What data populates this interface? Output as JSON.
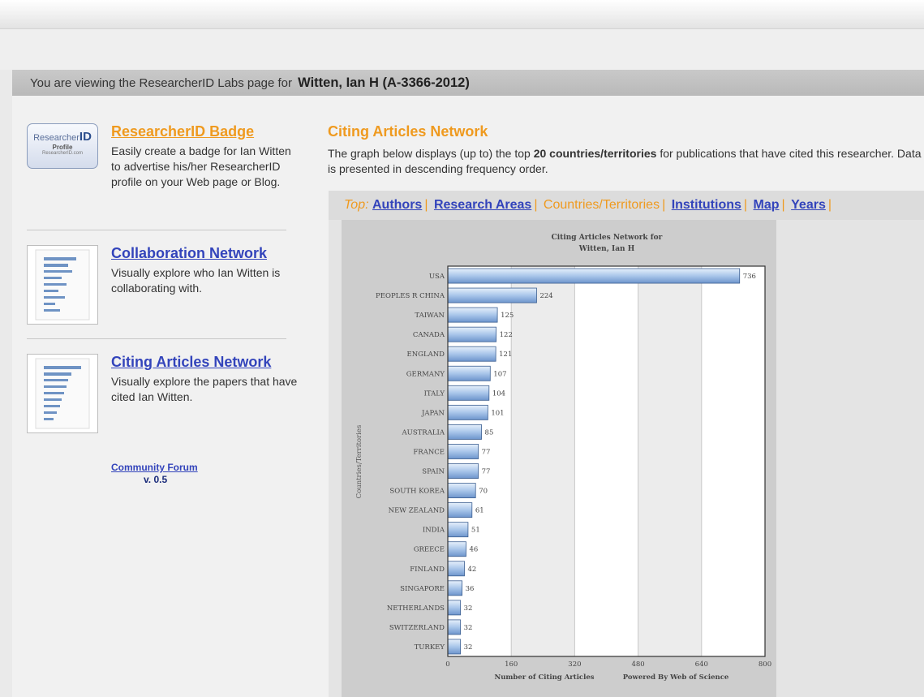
{
  "banner": {
    "prefix": "You are viewing the ResearcherID Labs page for",
    "researcher": "Witten, Ian H (A-3366-2012)"
  },
  "badge_logo": {
    "word1": "ResearcherID",
    "word2": "Profile",
    "word3": "ResearcherID.com"
  },
  "features": [
    {
      "title": "ResearcherID Badge",
      "description": "Easily create a badge for Ian Witten to advertise his/her ResearcherID profile on your Web page or Blog.",
      "title_color": "#ef9a1f"
    },
    {
      "title": "Collaboration Network",
      "description": "Visually explore who Ian Witten is collaborating with."
    },
    {
      "title": "Citing Articles Network",
      "description": "Visually explore the papers that have cited Ian Witten."
    }
  ],
  "community_forum": "Community Forum",
  "version": "v. 0.5",
  "main": {
    "title": "Citing Articles Network",
    "description_part1": "The graph below displays (up to) the top",
    "description_bold": "20 countries/territories",
    "description_part2": "for publications that have cited this researcher. Data is presented in descending frequency order."
  },
  "nav": {
    "prefix": "Top:",
    "items": [
      "Authors",
      "Research Areas",
      "Countries/Territories",
      "Institutions",
      "Map",
      "Years"
    ],
    "current": "Countries/Territories"
  },
  "colors": {
    "accent": "#ef9a1f",
    "link": "#3344bb",
    "bar": "#8fb3e0"
  },
  "chart_data": {
    "type": "bar",
    "orientation": "horizontal",
    "title_line1": "Citing Articles Network for",
    "title_line2": "Witten, Ian H",
    "xlabel": "Number of Citing Articles",
    "ylabel": "Countries/Territories",
    "footer": "Powered By Web of Science",
    "xlim": [
      0,
      800
    ],
    "xticks": [
      0,
      160,
      320,
      480,
      640,
      800
    ],
    "grid": "vertical",
    "categories": [
      "USA",
      "PEOPLES R CHINA",
      "TAIWAN",
      "CANADA",
      "ENGLAND",
      "GERMANY",
      "ITALY",
      "JAPAN",
      "AUSTRALIA",
      "FRANCE",
      "SPAIN",
      "SOUTH KOREA",
      "NEW ZEALAND",
      "INDIA",
      "GREECE",
      "FINLAND",
      "SINGAPORE",
      "NETHERLANDS",
      "SWITZERLAND",
      "TURKEY"
    ],
    "values": [
      736,
      224,
      125,
      122,
      121,
      107,
      104,
      101,
      85,
      77,
      77,
      70,
      61,
      51,
      46,
      42,
      36,
      32,
      32,
      32
    ]
  }
}
